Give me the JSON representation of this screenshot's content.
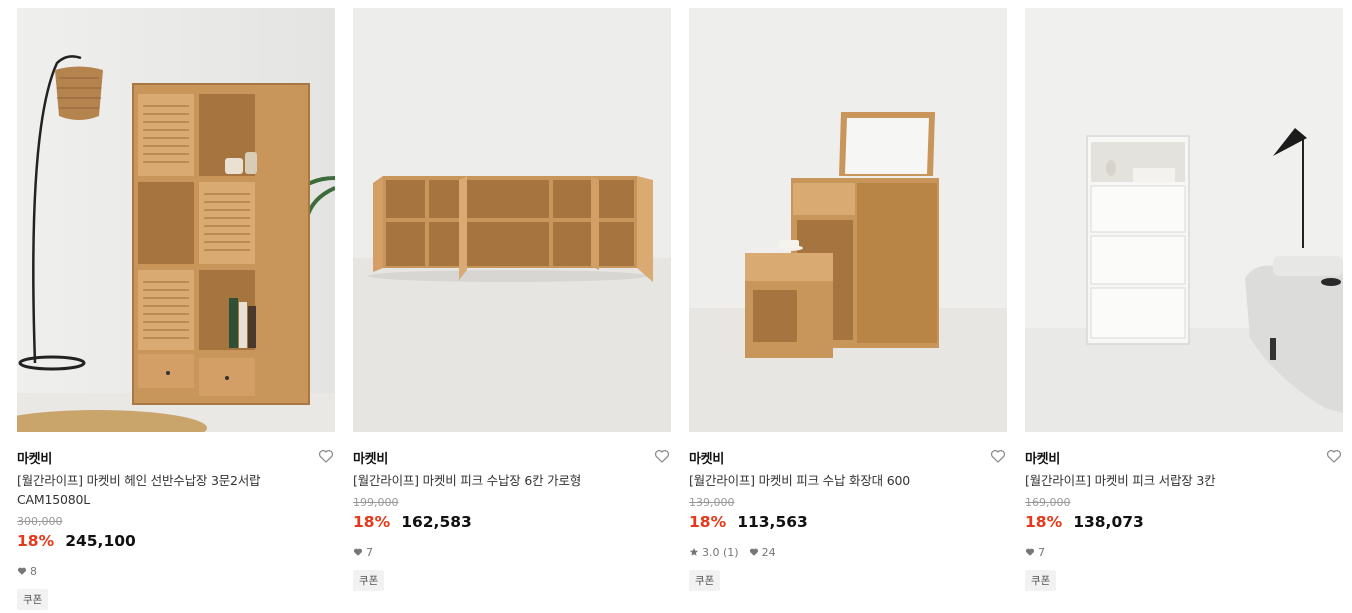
{
  "products": [
    {
      "brand": "마켓비",
      "name": "[월간라이프] 마켓비 헤인 선반수납장 3문2서랍 CAM15080L",
      "original_price": "300,000",
      "discount_rate": "18%",
      "price": "245,100",
      "likes": "8",
      "coupon": "쿠폰"
    },
    {
      "brand": "마켓비",
      "name": "[월간라이프] 마켓비 피크 수납장 6칸 가로형",
      "original_price": "199,000",
      "discount_rate": "18%",
      "price": "162,583",
      "likes": "7",
      "coupon": "쿠폰"
    },
    {
      "brand": "마켓비",
      "name": "[월간라이프] 마켓비 피크 수납 화장대 600",
      "original_price": "139,000",
      "discount_rate": "18%",
      "price": "113,563",
      "rating": "3.0 (1)",
      "likes": "24",
      "coupon": "쿠폰"
    },
    {
      "brand": "마켓비",
      "name": "[월간라이프] 마켓비 피크 서랍장 3칸",
      "original_price": "169,000",
      "discount_rate": "18%",
      "price": "138,073",
      "likes": "7",
      "coupon": "쿠폰"
    }
  ],
  "icons": {
    "wishlist": "heart-outline-icon",
    "likes": "heart-filled-icon",
    "rating": "star-icon"
  },
  "colors": {
    "discount": "#e6391c",
    "wood": "#c8955b",
    "muted": "#9a9a9a"
  }
}
